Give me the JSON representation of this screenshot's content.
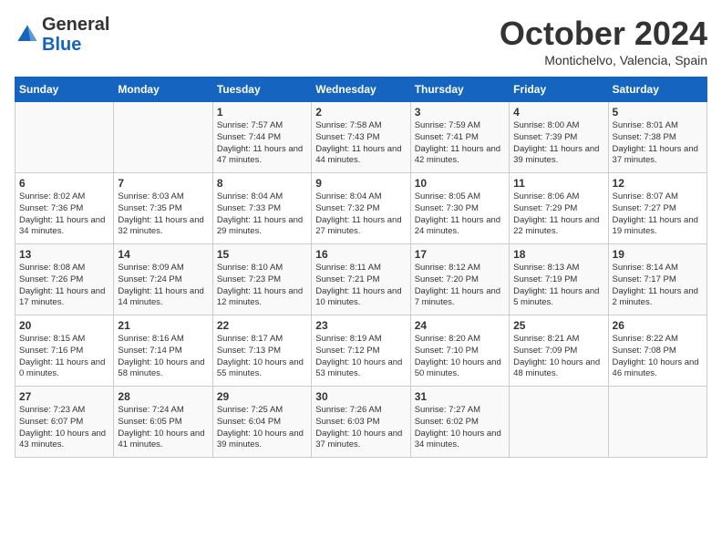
{
  "header": {
    "logo_general": "General",
    "logo_blue": "Blue",
    "month_title": "October 2024",
    "location": "Montichelvo, Valencia, Spain"
  },
  "days_of_week": [
    "Sunday",
    "Monday",
    "Tuesday",
    "Wednesday",
    "Thursday",
    "Friday",
    "Saturday"
  ],
  "weeks": [
    [
      {
        "day": "",
        "text": ""
      },
      {
        "day": "",
        "text": ""
      },
      {
        "day": "1",
        "text": "Sunrise: 7:57 AM\nSunset: 7:44 PM\nDaylight: 11 hours and 47 minutes."
      },
      {
        "day": "2",
        "text": "Sunrise: 7:58 AM\nSunset: 7:43 PM\nDaylight: 11 hours and 44 minutes."
      },
      {
        "day": "3",
        "text": "Sunrise: 7:59 AM\nSunset: 7:41 PM\nDaylight: 11 hours and 42 minutes."
      },
      {
        "day": "4",
        "text": "Sunrise: 8:00 AM\nSunset: 7:39 PM\nDaylight: 11 hours and 39 minutes."
      },
      {
        "day": "5",
        "text": "Sunrise: 8:01 AM\nSunset: 7:38 PM\nDaylight: 11 hours and 37 minutes."
      }
    ],
    [
      {
        "day": "6",
        "text": "Sunrise: 8:02 AM\nSunset: 7:36 PM\nDaylight: 11 hours and 34 minutes."
      },
      {
        "day": "7",
        "text": "Sunrise: 8:03 AM\nSunset: 7:35 PM\nDaylight: 11 hours and 32 minutes."
      },
      {
        "day": "8",
        "text": "Sunrise: 8:04 AM\nSunset: 7:33 PM\nDaylight: 11 hours and 29 minutes."
      },
      {
        "day": "9",
        "text": "Sunrise: 8:04 AM\nSunset: 7:32 PM\nDaylight: 11 hours and 27 minutes."
      },
      {
        "day": "10",
        "text": "Sunrise: 8:05 AM\nSunset: 7:30 PM\nDaylight: 11 hours and 24 minutes."
      },
      {
        "day": "11",
        "text": "Sunrise: 8:06 AM\nSunset: 7:29 PM\nDaylight: 11 hours and 22 minutes."
      },
      {
        "day": "12",
        "text": "Sunrise: 8:07 AM\nSunset: 7:27 PM\nDaylight: 11 hours and 19 minutes."
      }
    ],
    [
      {
        "day": "13",
        "text": "Sunrise: 8:08 AM\nSunset: 7:26 PM\nDaylight: 11 hours and 17 minutes."
      },
      {
        "day": "14",
        "text": "Sunrise: 8:09 AM\nSunset: 7:24 PM\nDaylight: 11 hours and 14 minutes."
      },
      {
        "day": "15",
        "text": "Sunrise: 8:10 AM\nSunset: 7:23 PM\nDaylight: 11 hours and 12 minutes."
      },
      {
        "day": "16",
        "text": "Sunrise: 8:11 AM\nSunset: 7:21 PM\nDaylight: 11 hours and 10 minutes."
      },
      {
        "day": "17",
        "text": "Sunrise: 8:12 AM\nSunset: 7:20 PM\nDaylight: 11 hours and 7 minutes."
      },
      {
        "day": "18",
        "text": "Sunrise: 8:13 AM\nSunset: 7:19 PM\nDaylight: 11 hours and 5 minutes."
      },
      {
        "day": "19",
        "text": "Sunrise: 8:14 AM\nSunset: 7:17 PM\nDaylight: 11 hours and 2 minutes."
      }
    ],
    [
      {
        "day": "20",
        "text": "Sunrise: 8:15 AM\nSunset: 7:16 PM\nDaylight: 11 hours and 0 minutes."
      },
      {
        "day": "21",
        "text": "Sunrise: 8:16 AM\nSunset: 7:14 PM\nDaylight: 10 hours and 58 minutes."
      },
      {
        "day": "22",
        "text": "Sunrise: 8:17 AM\nSunset: 7:13 PM\nDaylight: 10 hours and 55 minutes."
      },
      {
        "day": "23",
        "text": "Sunrise: 8:19 AM\nSunset: 7:12 PM\nDaylight: 10 hours and 53 minutes."
      },
      {
        "day": "24",
        "text": "Sunrise: 8:20 AM\nSunset: 7:10 PM\nDaylight: 10 hours and 50 minutes."
      },
      {
        "day": "25",
        "text": "Sunrise: 8:21 AM\nSunset: 7:09 PM\nDaylight: 10 hours and 48 minutes."
      },
      {
        "day": "26",
        "text": "Sunrise: 8:22 AM\nSunset: 7:08 PM\nDaylight: 10 hours and 46 minutes."
      }
    ],
    [
      {
        "day": "27",
        "text": "Sunrise: 7:23 AM\nSunset: 6:07 PM\nDaylight: 10 hours and 43 minutes."
      },
      {
        "day": "28",
        "text": "Sunrise: 7:24 AM\nSunset: 6:05 PM\nDaylight: 10 hours and 41 minutes."
      },
      {
        "day": "29",
        "text": "Sunrise: 7:25 AM\nSunset: 6:04 PM\nDaylight: 10 hours and 39 minutes."
      },
      {
        "day": "30",
        "text": "Sunrise: 7:26 AM\nSunset: 6:03 PM\nDaylight: 10 hours and 37 minutes."
      },
      {
        "day": "31",
        "text": "Sunrise: 7:27 AM\nSunset: 6:02 PM\nDaylight: 10 hours and 34 minutes."
      },
      {
        "day": "",
        "text": ""
      },
      {
        "day": "",
        "text": ""
      }
    ]
  ]
}
